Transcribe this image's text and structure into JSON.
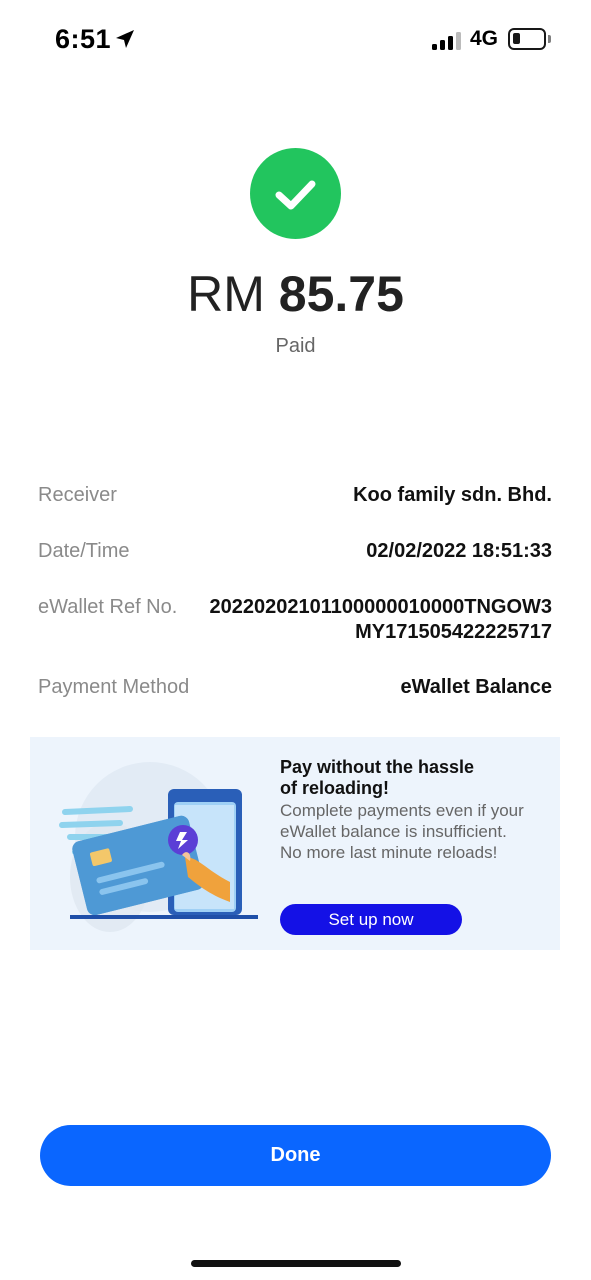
{
  "status_bar": {
    "time": "6:51",
    "network": "4G",
    "icons": [
      "location-arrow-icon",
      "signal-icon",
      "battery-icon"
    ]
  },
  "payment": {
    "currency": "RM",
    "amount": "85.75",
    "status": "Paid",
    "status_icon": "checkmark-icon",
    "status_color": "#22c55e"
  },
  "details": [
    {
      "label": "Receiver",
      "value": "Koo family sdn. Bhd."
    },
    {
      "label": "Date/Time",
      "value": "02/02/2022 18:51:33"
    },
    {
      "label": "eWallet Ref No.",
      "value_line1": "20220202101100000010000TNGOW3",
      "value_line2": "MY171505422225717"
    },
    {
      "label": "Payment Method",
      "value": "eWallet Balance"
    }
  ],
  "promo": {
    "title_line1": "Pay without the hassle",
    "title_line2": "of reloading!",
    "desc_line1": "Complete payments even if your",
    "desc_line2": "eWallet balance is insufficient.",
    "desc_line3": "No more last minute reloads!",
    "button_label": "Set up now",
    "button_color": "#1411e6",
    "background": "#edf4fc"
  },
  "done_button": {
    "label": "Done",
    "color": "#0a66ff"
  }
}
